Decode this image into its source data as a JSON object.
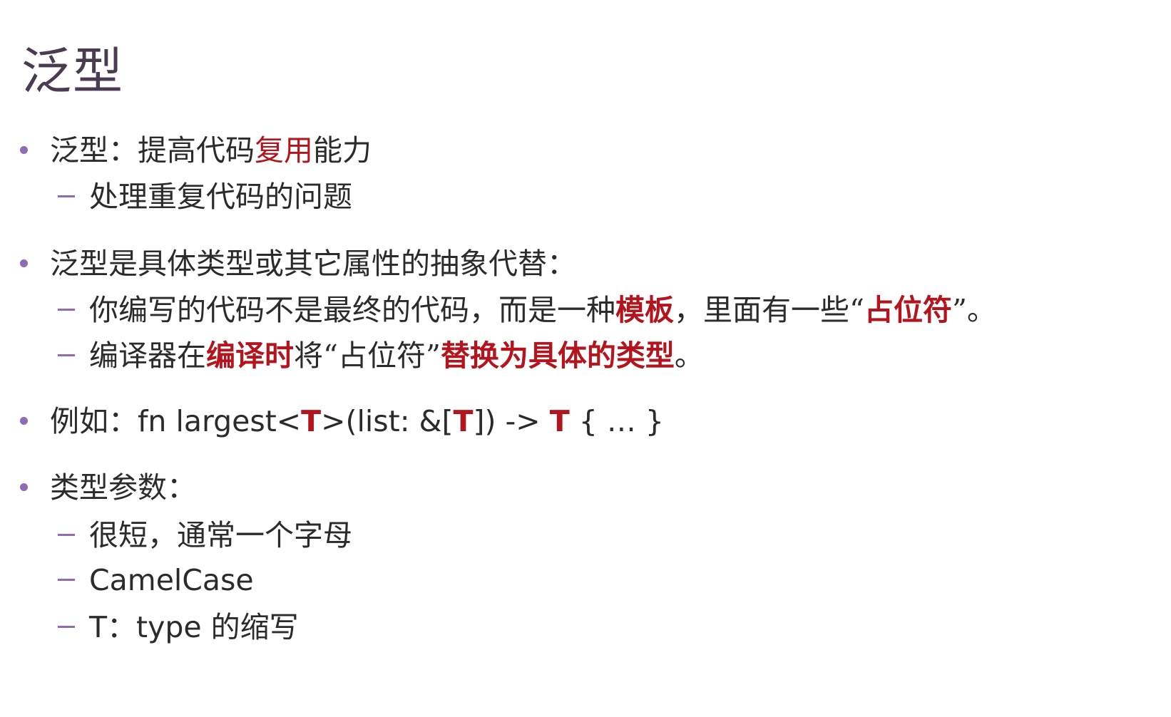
{
  "title": "泛型",
  "items": [
    {
      "parts": [
        {
          "text": "泛型：提高代码",
          "style": ""
        },
        {
          "text": "复用",
          "style": "red"
        },
        {
          "text": "能力",
          "style": ""
        }
      ],
      "subs": [
        {
          "parts": [
            {
              "text": "处理重复代码的问题",
              "style": ""
            }
          ]
        }
      ]
    },
    {
      "parts": [
        {
          "text": "泛型是具体类型或其它属性的抽象代替：",
          "style": ""
        }
      ],
      "subs": [
        {
          "parts": [
            {
              "text": "你编写的代码不是最终的代码，而是一种",
              "style": ""
            },
            {
              "text": "模板",
              "style": "red bold"
            },
            {
              "text": "，里面有一些“",
              "style": ""
            },
            {
              "text": "占位符",
              "style": "red bold"
            },
            {
              "text": "”。",
              "style": ""
            }
          ]
        },
        {
          "parts": [
            {
              "text": "编译器在",
              "style": ""
            },
            {
              "text": "编译时",
              "style": "red bold"
            },
            {
              "text": "将“占位符”",
              "style": ""
            },
            {
              "text": "替换为具体的类型",
              "style": "red bold"
            },
            {
              "text": "。",
              "style": ""
            }
          ]
        }
      ]
    },
    {
      "parts": [
        {
          "text": "例如：",
          "style": ""
        },
        {
          "text": "fn largest<",
          "style": "sans"
        },
        {
          "text": "T",
          "style": "sans red bold"
        },
        {
          "text": ">(list: &[",
          "style": "sans"
        },
        {
          "text": "T",
          "style": "sans red bold"
        },
        {
          "text": "]) -> ",
          "style": "sans"
        },
        {
          "text": "T",
          "style": "sans red bold"
        },
        {
          "text": " { … }",
          "style": "sans"
        }
      ],
      "subs": []
    },
    {
      "parts": [
        {
          "text": "类型参数：",
          "style": ""
        }
      ],
      "subs": [
        {
          "parts": [
            {
              "text": "很短，通常一个字母",
              "style": ""
            }
          ]
        },
        {
          "parts": [
            {
              "text": "CamelCase",
              "style": "sans"
            }
          ]
        },
        {
          "parts": [
            {
              "text": "T",
              "style": "sans"
            },
            {
              "text": "：",
              "style": ""
            },
            {
              "text": "type",
              "style": "sans"
            },
            {
              "text": " 的缩写",
              "style": ""
            }
          ]
        }
      ]
    }
  ],
  "colors": {
    "accent": "#b3141d",
    "bullet": "#8e6bb3",
    "title": "#4a3b50"
  }
}
